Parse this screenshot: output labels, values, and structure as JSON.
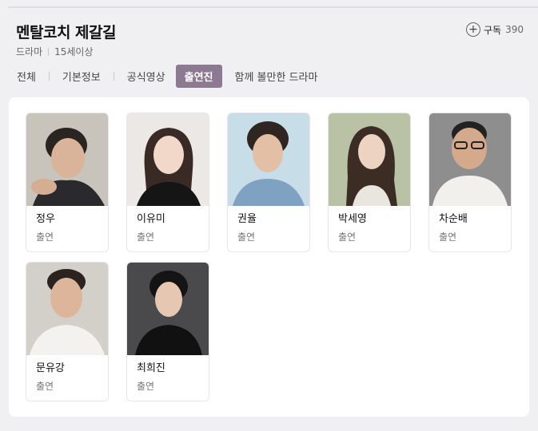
{
  "program": {
    "title": "멘탈코치 제갈길",
    "genre": "드라마",
    "rating": "15세이상"
  },
  "subscribe": {
    "label": "구독",
    "count": "390"
  },
  "tabs": [
    {
      "label": "전체"
    },
    {
      "label": "기본정보"
    },
    {
      "label": "공식영상"
    },
    {
      "label": "출연진",
      "active": true
    },
    {
      "label": "함께 볼만한 드라마"
    }
  ],
  "cast": [
    {
      "name": "정우",
      "role": "출연"
    },
    {
      "name": "이유미",
      "role": "출연"
    },
    {
      "name": "권율",
      "role": "출연"
    },
    {
      "name": "박세영",
      "role": "출연"
    },
    {
      "name": "차순배",
      "role": "출연"
    },
    {
      "name": "문유강",
      "role": "출연"
    },
    {
      "name": "최희진",
      "role": "출연"
    }
  ],
  "colors": {
    "active_tab": "#8d7a92",
    "background": "#f0eff2"
  }
}
